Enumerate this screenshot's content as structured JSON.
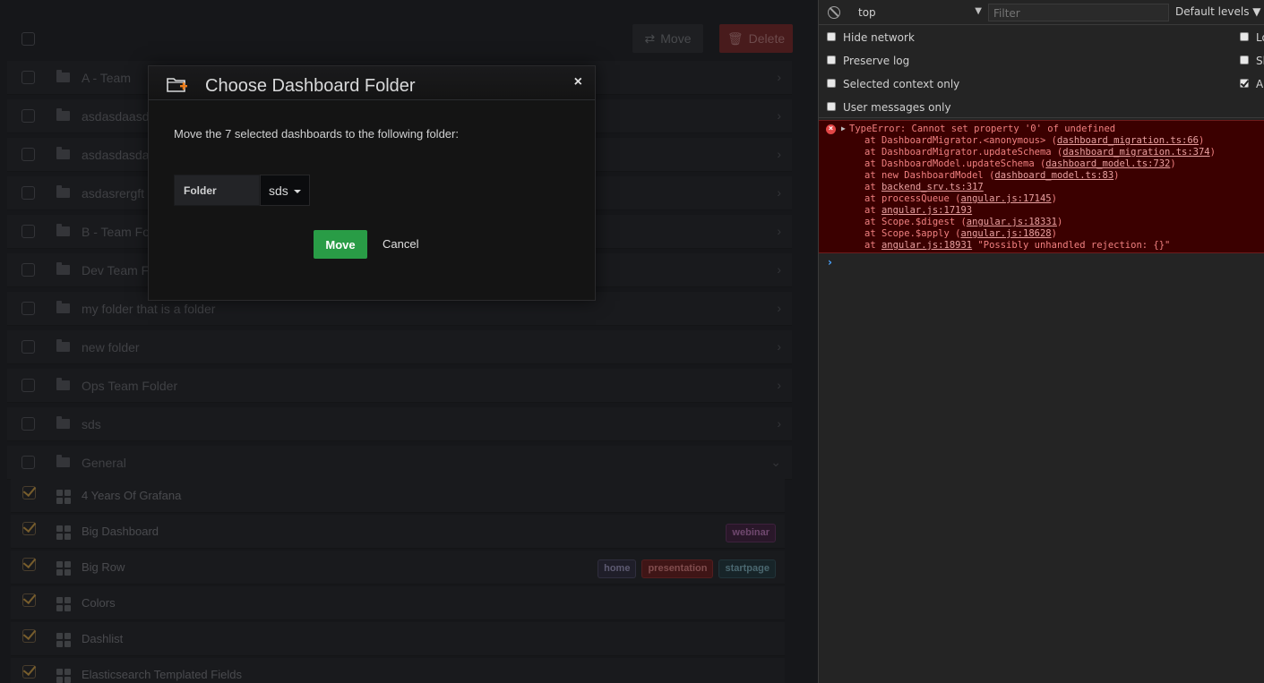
{
  "toolbar": {
    "move_label": "Move",
    "delete_label": "Delete"
  },
  "folders": [
    {
      "name": "A - Team"
    },
    {
      "name": "asdasdaasd"
    },
    {
      "name": "asdasdasda"
    },
    {
      "name": "asdasrergft"
    },
    {
      "name": "B - Team Fo"
    },
    {
      "name": "Dev Team Fo"
    },
    {
      "name": "my folder that is a folder"
    },
    {
      "name": "new folder"
    },
    {
      "name": "Ops Team Folder"
    },
    {
      "name": "sds"
    },
    {
      "name": "General"
    }
  ],
  "dashboards": [
    {
      "name": "4 Years Of Grafana",
      "checked": true,
      "tags": []
    },
    {
      "name": "Big Dashboard",
      "checked": true,
      "tags": [
        {
          "label": "webinar",
          "bg": "#3b1f3a",
          "color": "#a66aa3",
          "border": "#5a2e58"
        }
      ]
    },
    {
      "name": "Big Row",
      "checked": true,
      "tags": [
        {
          "label": "home",
          "bg": "#2b2a3a",
          "color": "#8a86a8",
          "border": "#45435a"
        },
        {
          "label": "presentation",
          "bg": "#5c1d1d",
          "color": "#c07070",
          "border": "#7a2a2a"
        },
        {
          "label": "startpage",
          "bg": "#203338",
          "color": "#6e9aa5",
          "border": "#2f4a52"
        }
      ]
    },
    {
      "name": "Colors",
      "checked": true,
      "tags": []
    },
    {
      "name": "Dashlist",
      "checked": true,
      "tags": []
    },
    {
      "name": "Elasticsearch Templated Fields",
      "checked": true,
      "tags": []
    }
  ],
  "modal": {
    "title": "Choose Dashboard Folder",
    "close": "×",
    "message": "Move the 7 selected dashboards to the following folder:",
    "folder_label": "Folder",
    "folder_value": "sds",
    "move_label": "Move",
    "cancel_label": "Cancel"
  },
  "devtools": {
    "context": "top",
    "filter_placeholder": "Filter",
    "levels": "Default levels ▼",
    "options_left": [
      "Hide network",
      "Preserve log",
      "Selected context only",
      "User messages only"
    ],
    "options_right": [
      {
        "label": "Lo",
        "checked": false
      },
      {
        "label": "Sh",
        "checked": false
      },
      {
        "label": "Au",
        "checked": true
      }
    ],
    "error": {
      "lines": [
        {
          "pre": "TypeError: Cannot set property '0' of undefined",
          "link": "",
          "post": ""
        },
        {
          "pre": "at DashboardMigrator.<anonymous> (",
          "link": "dashboard_migration.ts:66",
          "post": ")"
        },
        {
          "pre": "at DashboardMigrator.updateSchema (",
          "link": "dashboard_migration.ts:374",
          "post": ")"
        },
        {
          "pre": "at DashboardModel.updateSchema (",
          "link": "dashboard_model.ts:732",
          "post": ")"
        },
        {
          "pre": "at new DashboardModel (",
          "link": "dashboard_model.ts:83",
          "post": ")"
        },
        {
          "pre": "at ",
          "link": "backend_srv.ts:317",
          "post": ""
        },
        {
          "pre": "at processQueue (",
          "link": "angular.js:17145",
          "post": ")"
        },
        {
          "pre": "at ",
          "link": "angular.js:17193",
          "post": ""
        },
        {
          "pre": "at Scope.$digest (",
          "link": "angular.js:18331",
          "post": ")"
        },
        {
          "pre": "at Scope.$apply (",
          "link": "angular.js:18628",
          "post": ")"
        },
        {
          "pre": "at ",
          "link": "angular.js:18931",
          "post": " \"Possibly unhandled rejection: {}\""
        }
      ]
    },
    "prompt": "›"
  }
}
